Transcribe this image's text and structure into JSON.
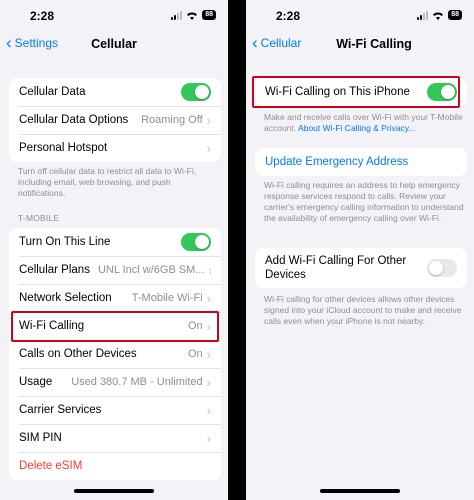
{
  "left_phone": {
    "status": {
      "time": "2:28",
      "battery": "88"
    },
    "nav": {
      "back_label": "Settings",
      "title": "Cellular"
    },
    "group1": [
      {
        "label": "Cellular Data",
        "toggle": "on"
      },
      {
        "label": "Cellular Data Options",
        "detail": "Roaming Off"
      },
      {
        "label": "Personal Hotspot",
        "detail": ""
      }
    ],
    "footnote1": "Turn off cellular data to restrict all data to Wi-Fi, including email, web browsing, and push notifications.",
    "section_header": "T-MOBILE",
    "group2": [
      {
        "label": "Turn On This Line",
        "toggle": "on"
      },
      {
        "label": "Cellular Plans",
        "detail": "UNL Incl w/6GB SM..."
      },
      {
        "label": "Network Selection",
        "detail": "T-Mobile Wi-Fi"
      },
      {
        "label": "Wi-Fi Calling",
        "detail": "On"
      },
      {
        "label": "Calls on Other Devices",
        "detail": "On"
      },
      {
        "label": "Usage",
        "detail": "Used 380.7 MB - Unlimited"
      },
      {
        "label": "Carrier Services",
        "detail": ""
      },
      {
        "label": "SIM PIN",
        "detail": ""
      },
      {
        "label": "Delete eSIM"
      }
    ]
  },
  "right_phone": {
    "status": {
      "time": "2:28",
      "battery": "88"
    },
    "nav": {
      "back_label": "Cellular",
      "title": "Wi-Fi Calling"
    },
    "wifi_calling_row": {
      "label": "Wi-Fi Calling on This iPhone",
      "toggle": "on"
    },
    "footnote1": "Make and receive calls over Wi-Fi with your T-Mobile account.",
    "footnote1_link": "About Wi-Fi Calling & Privacy...",
    "update_address_label": "Update Emergency Address",
    "footnote2": "Wi-Fi calling requires an address to help emergency response services respond to calls. Review your carrier's emergency calling information to understand the availability of emergency calling over Wi-Fi.",
    "other_devices_row": {
      "label": "Add Wi-Fi Calling For Other Devices",
      "toggle": "off"
    },
    "footnote3": "Wi-Fi calling for other devices allows other devices signed into your iCloud account to make and receive calls even when your iPhone is not nearby."
  },
  "colors": {
    "accent": "#007aff",
    "toggle_on": "#34c759",
    "highlight": "#d0021b",
    "destructive": "#ff3b30"
  }
}
